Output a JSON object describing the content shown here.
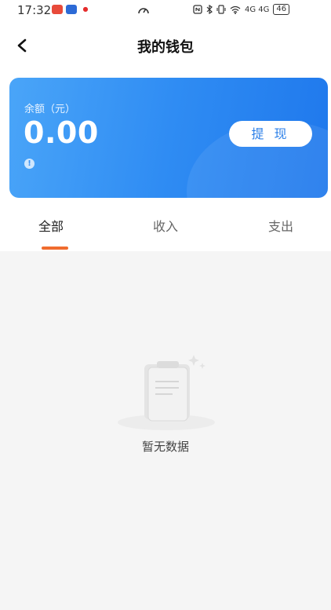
{
  "status_bar": {
    "time": "17:32",
    "right_status": "4G 4G",
    "battery": "46"
  },
  "header": {
    "title": "我的钱包"
  },
  "wallet": {
    "balance_label": "余额（元）",
    "balance_value": "0.00",
    "withdraw_label": "提 现",
    "colors": {
      "card_start": "#4aa5f8",
      "card_end": "#1f78ec"
    }
  },
  "tabs": [
    {
      "label": "全部",
      "active": true
    },
    {
      "label": "收入",
      "active": false
    },
    {
      "label": "支出",
      "active": false
    }
  ],
  "empty_state": {
    "text": "暂无数据",
    "icon": "clipboard-icon"
  },
  "colors": {
    "accent_indicator": "#f06c2e",
    "page_background": "#f5f5f5"
  }
}
